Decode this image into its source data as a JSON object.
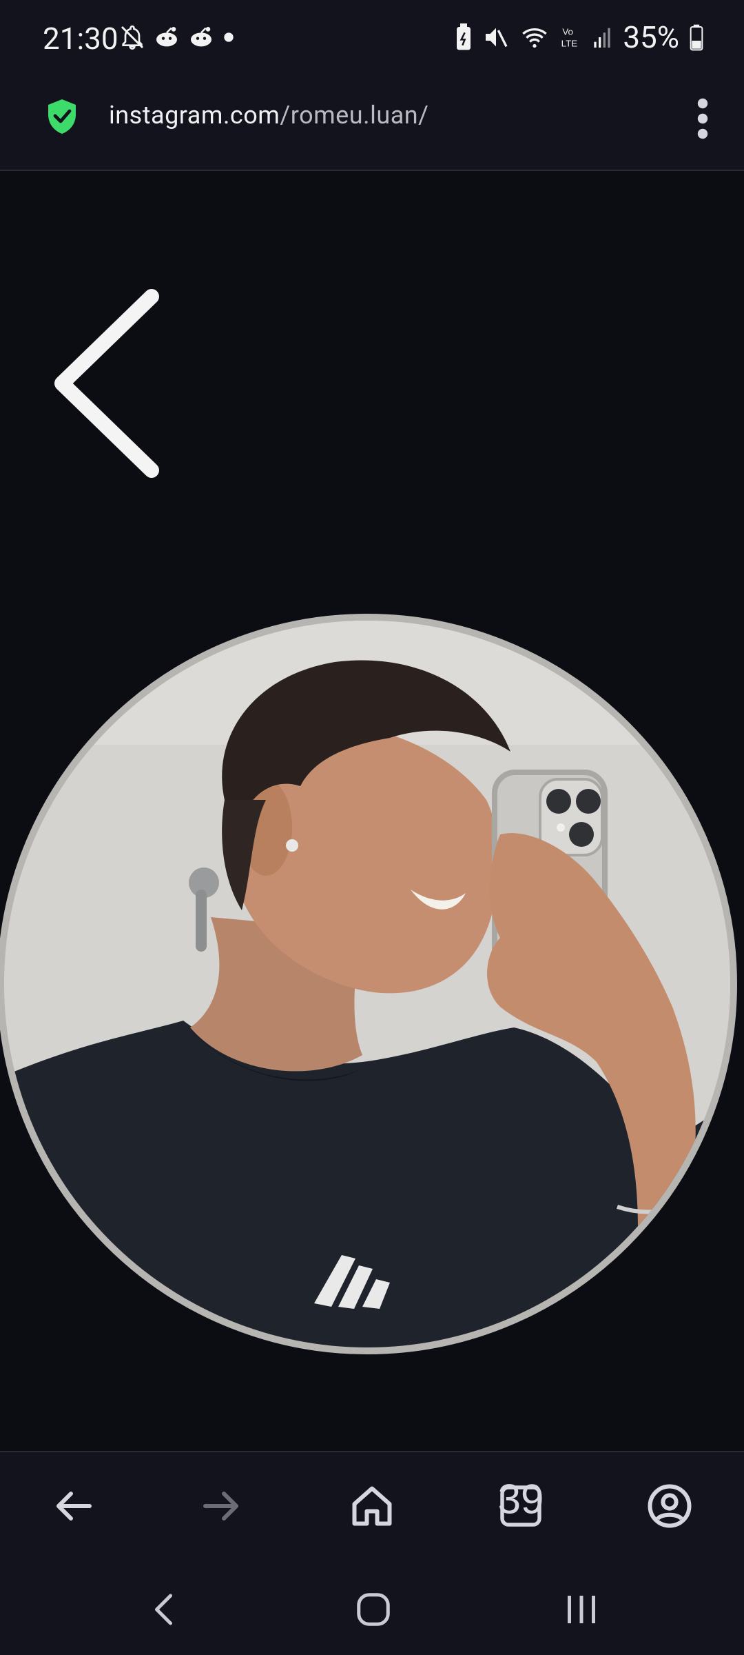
{
  "status_bar": {
    "time": "21:30",
    "battery_percent": "35%",
    "left_icons": [
      "notifications-off-icon",
      "reddit-icon",
      "reddit-icon",
      "dot-icon"
    ],
    "right_icons": [
      "battery-saver-icon",
      "mute-icon",
      "wifi-icon",
      "volte-icon",
      "signal-icon",
      "battery-icon"
    ]
  },
  "url_bar": {
    "domain": "instagram.com",
    "path": "/romeu.luan/",
    "secure_icon": "shield-check-icon",
    "menu_icon": "more-vert-icon"
  },
  "viewer": {
    "back_icon": "chevron-left-icon",
    "photo_alt": "Profile picture"
  },
  "browser_toolbar": {
    "tabs_count": "39",
    "buttons": [
      "back-arrow-icon",
      "forward-arrow-icon",
      "home-icon",
      "tabs-icon",
      "account-icon"
    ]
  },
  "nav_bar": {
    "buttons": [
      "nav-back-icon",
      "nav-home-icon",
      "nav-recents-icon"
    ]
  },
  "colors": {
    "background": "#0b0d12",
    "bar_background": "#13131d",
    "shield_green": "#3ddc6a",
    "icon_light": "#d5d6de",
    "icon_disabled": "#6b6c75"
  }
}
